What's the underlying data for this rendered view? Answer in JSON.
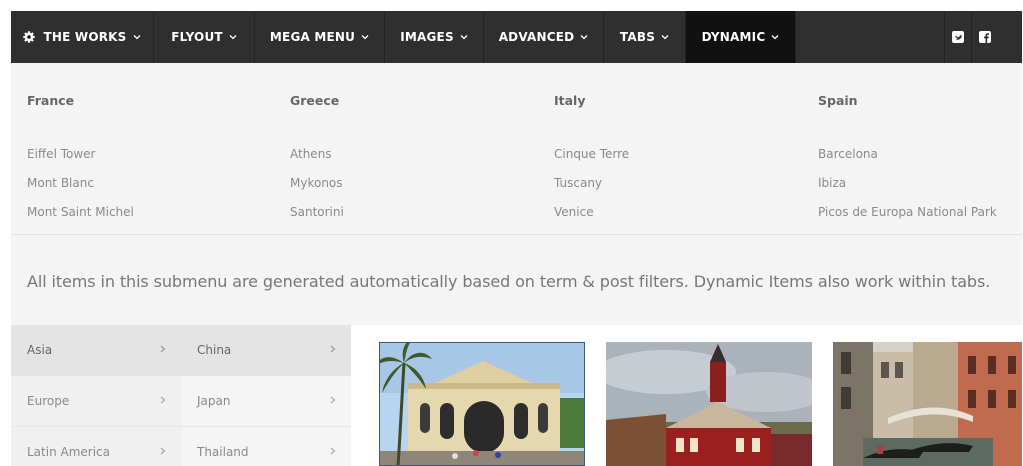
{
  "nav": {
    "items": [
      {
        "label": "THE WORKS",
        "active": false
      },
      {
        "label": "FLYOUT",
        "active": false
      },
      {
        "label": "MEGA MENU",
        "active": false
      },
      {
        "label": "IMAGES",
        "active": false
      },
      {
        "label": "ADVANCED",
        "active": false
      },
      {
        "label": "TABS",
        "active": false
      },
      {
        "label": "DYNAMIC",
        "active": true
      }
    ],
    "social": [
      "twitter-icon",
      "facebook-icon"
    ]
  },
  "columns": [
    {
      "heading": "France",
      "links": [
        "Eiffel Tower",
        "Mont Blanc",
        "Mont Saint Michel"
      ]
    },
    {
      "heading": "Greece",
      "links": [
        "Athens",
        "Mykonos",
        "Santorini"
      ]
    },
    {
      "heading": "Italy",
      "links": [
        "Cinque Terre",
        "Tuscany",
        "Venice"
      ]
    },
    {
      "heading": "Spain",
      "links": [
        "Barcelona",
        "Ibiza",
        "Picos de Europa National Park"
      ]
    }
  ],
  "description": "All items in this submenu are generated automatically based on term & post filters. Dynamic Items also work within tabs.",
  "region_tabs": [
    "Asia",
    "Europe",
    "Latin America"
  ],
  "country_tabs": [
    "China",
    "Japan",
    "Thailand"
  ],
  "colors": {
    "navbar": "#2f2f2f",
    "active_nav": "#111111",
    "panel": "#f4f4f4"
  }
}
